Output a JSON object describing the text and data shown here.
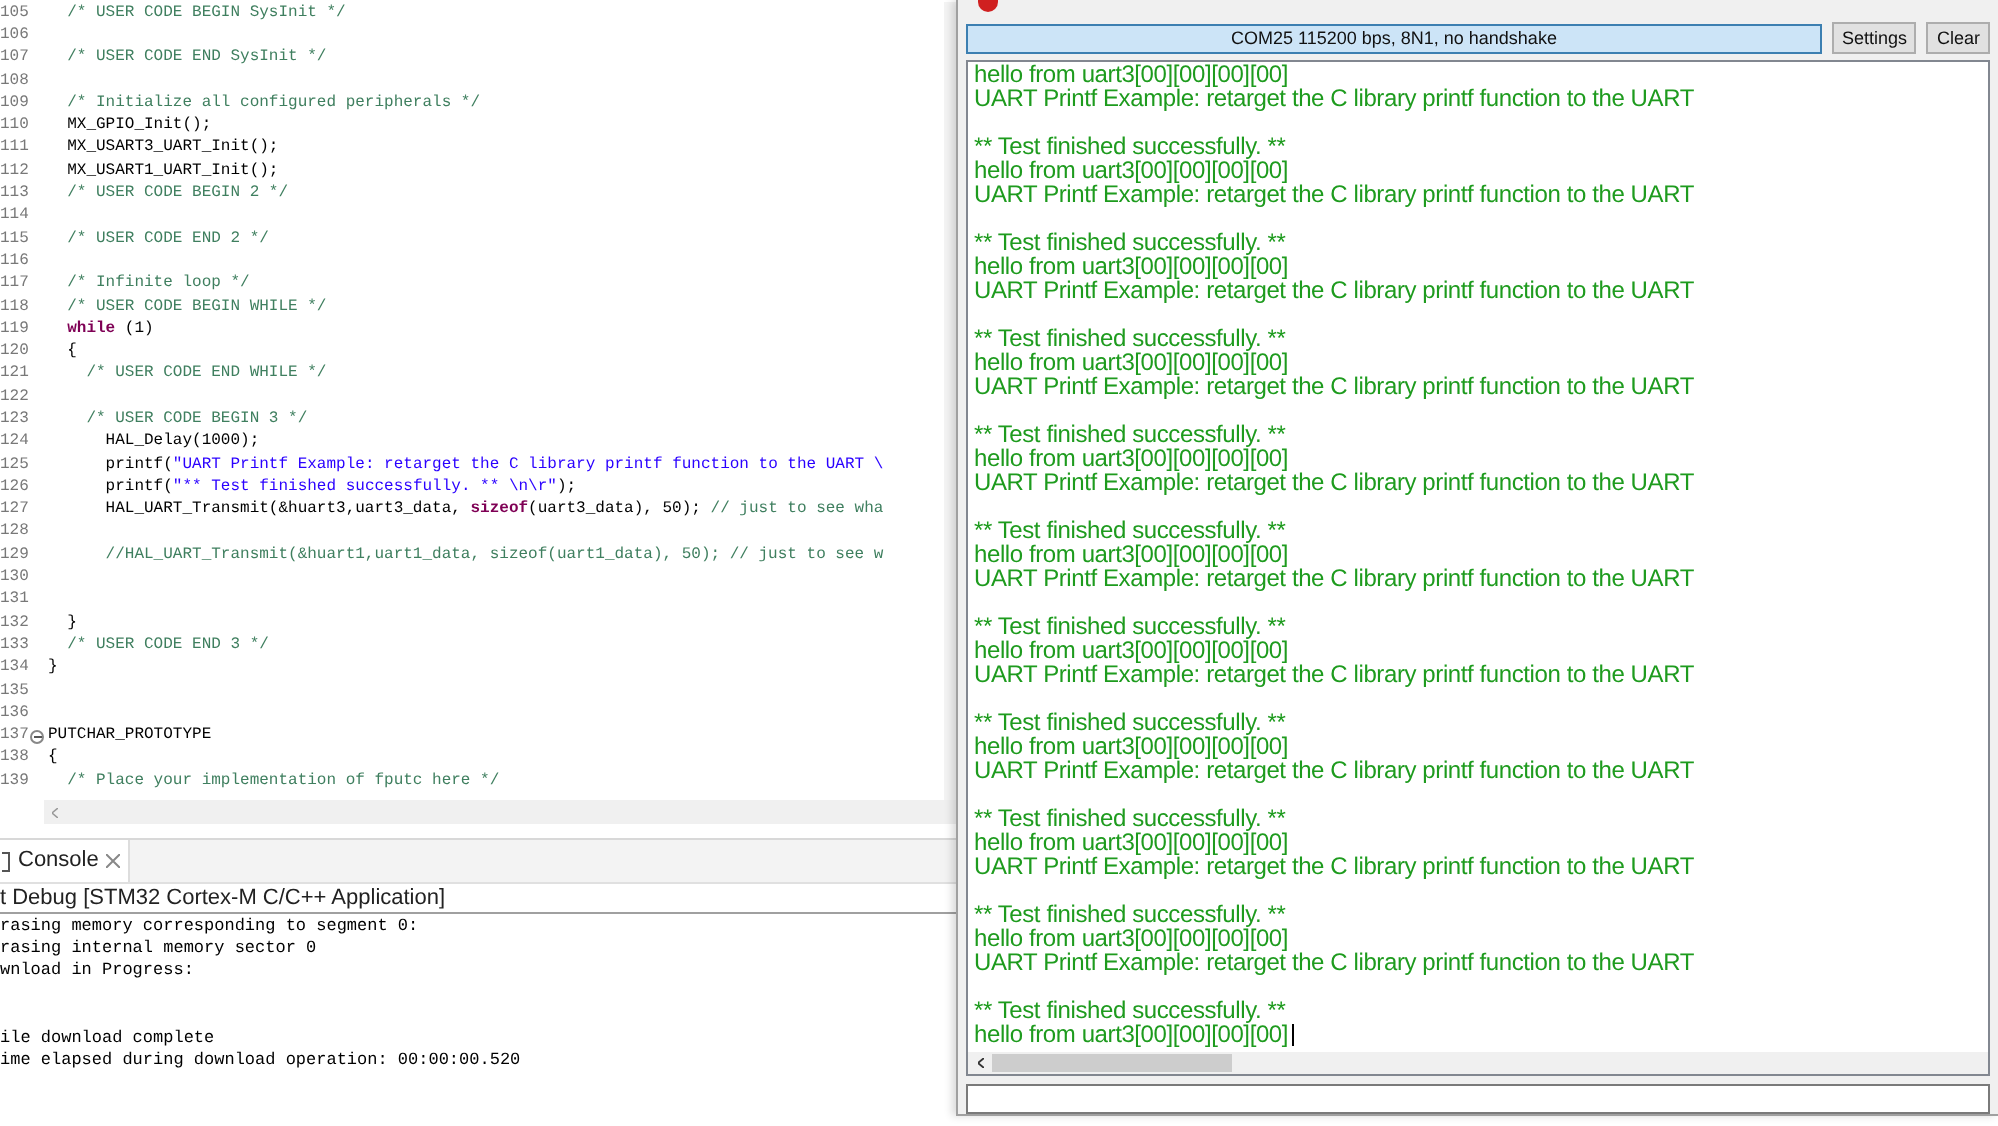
{
  "editor": {
    "lines": [
      {
        "number": "105",
        "parts": [
          {
            "kind": "comment",
            "text": "  /* USER CODE BEGIN SysInit */"
          }
        ]
      },
      {
        "number": "106"
      },
      {
        "number": "107",
        "parts": [
          {
            "kind": "comment",
            "text": "  /* USER CODE END SysInit */"
          }
        ]
      },
      {
        "number": "108"
      },
      {
        "number": "109",
        "parts": [
          {
            "kind": "comment",
            "text": "  /* Initialize all configured peripherals */"
          }
        ]
      },
      {
        "number": "110",
        "parts": [
          {
            "kind": "plain",
            "text": "  MX_GPIO_Init();"
          }
        ]
      },
      {
        "number": "111",
        "parts": [
          {
            "kind": "plain",
            "text": "  MX_USART3_UART_Init();"
          }
        ]
      },
      {
        "number": "112",
        "parts": [
          {
            "kind": "plain",
            "text": "  MX_USART1_UART_Init();"
          }
        ]
      },
      {
        "number": "113",
        "parts": [
          {
            "kind": "comment",
            "text": "  /* USER CODE BEGIN 2 */"
          }
        ]
      },
      {
        "number": "114"
      },
      {
        "number": "115",
        "parts": [
          {
            "kind": "comment",
            "text": "  /* USER CODE END 2 */"
          }
        ]
      },
      {
        "number": "116"
      },
      {
        "number": "117",
        "parts": [
          {
            "kind": "comment",
            "text": "  /* Infinite loop */"
          }
        ]
      },
      {
        "number": "118",
        "parts": [
          {
            "kind": "comment",
            "text": "  /* USER CODE BEGIN WHILE */"
          }
        ]
      },
      {
        "number": "119",
        "parts": [
          {
            "kind": "keyword",
            "text": "  while"
          },
          {
            "kind": "plain",
            "text": " (1)"
          }
        ]
      },
      {
        "number": "120",
        "parts": [
          {
            "kind": "plain",
            "text": "  {"
          }
        ]
      },
      {
        "number": "121",
        "parts": [
          {
            "kind": "comment",
            "text": "    /* USER CODE END WHILE */"
          }
        ]
      },
      {
        "number": "122"
      },
      {
        "number": "123",
        "parts": [
          {
            "kind": "comment",
            "text": "    /* USER CODE BEGIN 3 */"
          }
        ]
      },
      {
        "number": "124",
        "parts": [
          {
            "kind": "plain",
            "text": "      HAL_Delay(1000);"
          }
        ]
      },
      {
        "number": "125",
        "parts": [
          {
            "kind": "plain",
            "text": "      printf("
          },
          {
            "kind": "string",
            "text": "\"UART Printf Example: retarget the C library printf function to the UART \\"
          }
        ]
      },
      {
        "number": "126",
        "parts": [
          {
            "kind": "plain",
            "text": "      printf("
          },
          {
            "kind": "string",
            "text": "\"** Test finished successfully. ** \\n\\r\""
          },
          {
            "kind": "plain",
            "text": ");"
          }
        ]
      },
      {
        "number": "127",
        "parts": [
          {
            "kind": "plain",
            "text": "      HAL_UART_Transmit(&huart3,uart3_data, "
          },
          {
            "kind": "keyword",
            "text": "sizeof"
          },
          {
            "kind": "plain",
            "text": "(uart3_data), 50); "
          },
          {
            "kind": "comment",
            "text": "// just to see wha"
          }
        ]
      },
      {
        "number": "128"
      },
      {
        "number": "129",
        "parts": [
          {
            "kind": "comment",
            "text": "      //HAL_UART_Transmit(&huart1,uart1_data, sizeof(uart1_data), 50); // just to see w"
          }
        ]
      },
      {
        "number": "130"
      },
      {
        "number": "131"
      },
      {
        "number": "132",
        "parts": [
          {
            "kind": "plain",
            "text": "  }"
          }
        ]
      },
      {
        "number": "133",
        "parts": [
          {
            "kind": "comment",
            "text": "  /* USER CODE END 3 */"
          }
        ]
      },
      {
        "number": "134",
        "parts": [
          {
            "kind": "plain",
            "text": "}"
          }
        ]
      },
      {
        "number": "135"
      },
      {
        "number": "136"
      },
      {
        "number": "137",
        "expanded": true,
        "parts": [
          {
            "kind": "plain",
            "text": "PUTCHAR_PROTOTYPE"
          }
        ]
      },
      {
        "number": "138",
        "parts": [
          {
            "kind": "plain",
            "text": "{"
          }
        ]
      },
      {
        "number": "139",
        "parts": [
          {
            "kind": "comment",
            "text": "  /* Place your implementation of fputc here */"
          }
        ]
      }
    ]
  },
  "console": {
    "tab": "Console",
    "header": "t Debug [STM32 Cortex-M C/C++ Application]",
    "lines": [
      {
        "kind": "text",
        "text": "rasing memory corresponding to segment 0:"
      },
      {
        "kind": "text",
        "text": "rasing internal memory sector 0"
      },
      {
        "kind": "text",
        "text": "wnload in Progress:"
      },
      {
        "kind": "blank"
      },
      {
        "kind": "blank"
      },
      {
        "kind": "text",
        "text": "ile download complete"
      },
      {
        "kind": "text",
        "text": "ime elapsed during download operation: 00:00:00.520"
      }
    ]
  },
  "terminal": {
    "status": "COM25 115200 bps, 8N1, no handshake",
    "buttons": [
      "Settings",
      "Clear"
    ],
    "lines": [
      {
        "kind": "text",
        "text": "hello from uart3[00][00][00][00]"
      },
      {
        "kind": "text",
        "text": "UART Printf Example: retarget the C library printf function to the UART"
      },
      {
        "kind": "blank"
      },
      {
        "kind": "text",
        "text": "** Test finished successfully. **"
      },
      {
        "kind": "text",
        "text": "hello from uart3[00][00][00][00]"
      },
      {
        "kind": "text",
        "text": "UART Printf Example: retarget the C library printf function to the UART"
      },
      {
        "kind": "blank"
      },
      {
        "kind": "text",
        "text": "** Test finished successfully. **"
      },
      {
        "kind": "text",
        "text": "hello from uart3[00][00][00][00]"
      },
      {
        "kind": "text",
        "text": "UART Printf Example: retarget the C library printf function to the UART"
      },
      {
        "kind": "blank"
      },
      {
        "kind": "text",
        "text": "** Test finished successfully. **"
      },
      {
        "kind": "text",
        "text": "hello from uart3[00][00][00][00]"
      },
      {
        "kind": "text",
        "text": "UART Printf Example: retarget the C library printf function to the UART"
      },
      {
        "kind": "blank"
      },
      {
        "kind": "text",
        "text": "** Test finished successfully. **"
      },
      {
        "kind": "text",
        "text": "hello from uart3[00][00][00][00]"
      },
      {
        "kind": "text",
        "text": "UART Printf Example: retarget the C library printf function to the UART"
      },
      {
        "kind": "blank"
      },
      {
        "kind": "text",
        "text": "** Test finished successfully. **"
      },
      {
        "kind": "text",
        "text": "hello from uart3[00][00][00][00]"
      },
      {
        "kind": "text",
        "text": "UART Printf Example: retarget the C library printf function to the UART"
      },
      {
        "kind": "blank"
      },
      {
        "kind": "text",
        "text": "** Test finished successfully. **"
      },
      {
        "kind": "text",
        "text": "hello from uart3[00][00][00][00]"
      },
      {
        "kind": "text",
        "text": "UART Printf Example: retarget the C library printf function to the UART"
      },
      {
        "kind": "blank"
      },
      {
        "kind": "text",
        "text": "** Test finished successfully. **"
      },
      {
        "kind": "text",
        "text": "hello from uart3[00][00][00][00]"
      },
      {
        "kind": "text",
        "text": "UART Printf Example: retarget the C library printf function to the UART"
      },
      {
        "kind": "blank"
      },
      {
        "kind": "text",
        "text": "** Test finished successfully. **"
      },
      {
        "kind": "text",
        "text": "hello from uart3[00][00][00][00]"
      },
      {
        "kind": "text",
        "text": "UART Printf Example: retarget the C library printf function to the UART"
      },
      {
        "kind": "blank"
      },
      {
        "kind": "text",
        "text": "** Test finished successfully. **"
      },
      {
        "kind": "text",
        "text": "hello from uart3[00][00][00][00]"
      },
      {
        "kind": "text",
        "text": "UART Printf Example: retarget the C library printf function to the UART"
      },
      {
        "kind": "blank"
      },
      {
        "kind": "text",
        "text": "** Test finished successfully. **"
      },
      {
        "kind": "text",
        "text": "hello from uart3[00][00][00][00]"
      }
    ]
  }
}
